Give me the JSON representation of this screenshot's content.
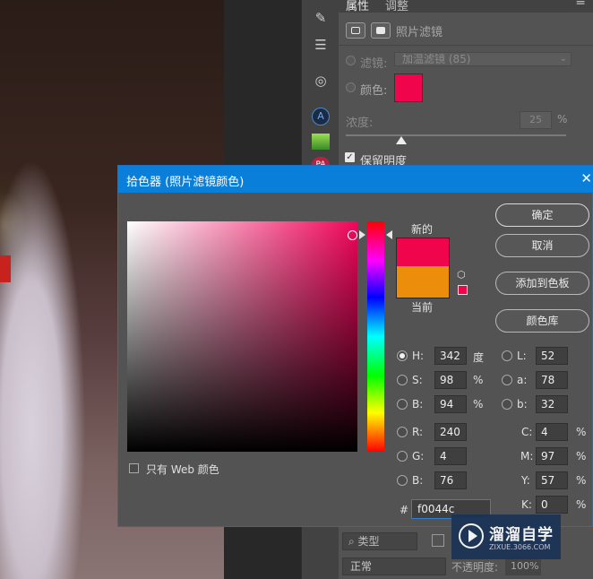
{
  "panel": {
    "tabs": [
      "属性",
      "调整"
    ],
    "menu_icon": "menu-icon",
    "header_title": "照片滤镜",
    "filter_label": "滤镜:",
    "filter_value": "加温滤镜 (85)",
    "color_label": "颜色:",
    "color_hex": "#f0044c",
    "density_label": "浓度:",
    "density_value": "25",
    "density_unit": "%",
    "density_level": 0.25,
    "preserve_label": "保留明度",
    "preserve_checked": true
  },
  "toolstrip": {
    "icons": [
      "brush-icon",
      "sliders-icon",
      "target-icon",
      "app-a-icon",
      "app-cube-icon",
      "app-pa-icon"
    ]
  },
  "layers": {
    "type_filter": "类型",
    "blend_mode": "正常",
    "opacity_label": "不透明度:",
    "opacity_value": "100%"
  },
  "dialog": {
    "title": "拾色器 (照片滤镜颜色)",
    "only_web_label": "只有 Web 颜色",
    "new_label": "新的",
    "current_label": "当前",
    "new_color": "#f0044c",
    "current_color": "#ec8d0c",
    "buttons": {
      "ok": "确定",
      "cancel": "取消",
      "add_to_swatches": "添加到色板",
      "color_libraries": "颜色库"
    },
    "hsb": {
      "h_label": "H:",
      "h_value": "342",
      "h_unit": "度",
      "s_label": "S:",
      "s_value": "98",
      "s_unit": "%",
      "b_label": "B:",
      "b_value": "94",
      "b_unit": "%"
    },
    "lab": {
      "l_label": "L:",
      "l_value": "52",
      "a_label": "a:",
      "a_value": "78",
      "b_label": "b:",
      "b_value": "32"
    },
    "rgb": {
      "r_label": "R:",
      "r_value": "240",
      "g_label": "G:",
      "g_value": "4",
      "b_label": "B:",
      "b_value": "76"
    },
    "cmyk": {
      "c_label": "C:",
      "c_value": "4",
      "c_unit": "%",
      "m_label": "M:",
      "m_value": "97",
      "m_unit": "%",
      "y_label": "Y:",
      "y_value": "57",
      "y_unit": "%",
      "k_label": "K:",
      "k_value": "0",
      "k_unit": "%"
    },
    "hex_label": "#",
    "hex_value": "f0044c"
  },
  "watermark": {
    "title": "溜溜自学",
    "subtitle": "ZIXUE.3066.COM"
  }
}
